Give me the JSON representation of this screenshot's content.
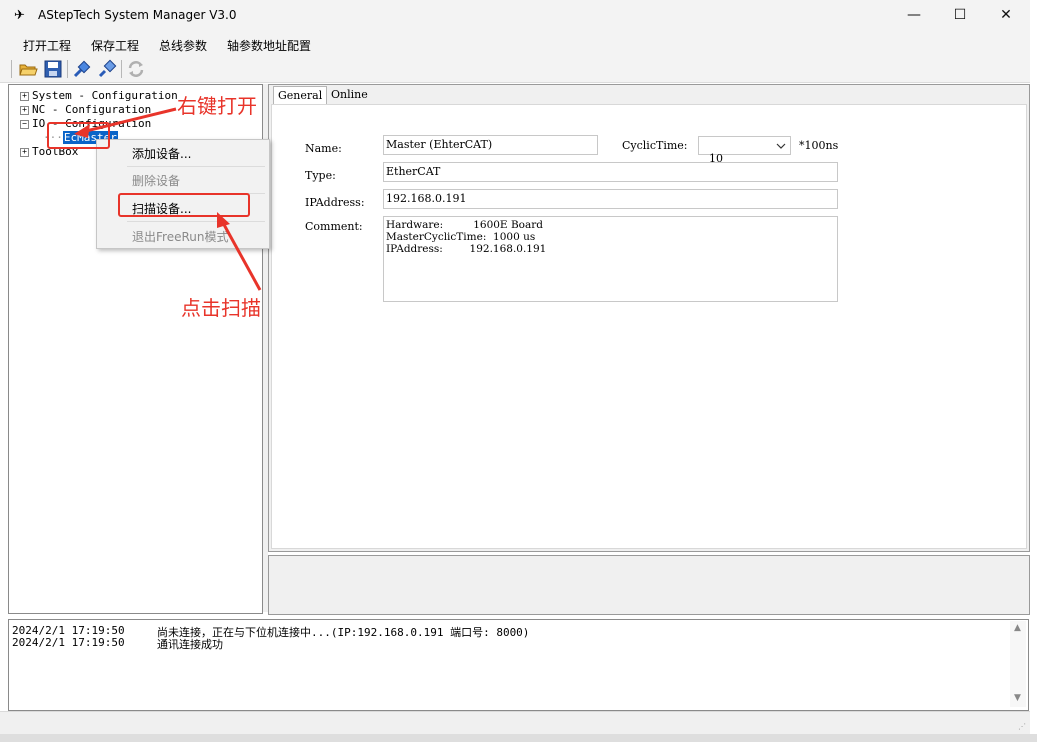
{
  "window": {
    "title": "AStepTech System Manager V3.0",
    "controls": {
      "minimize": "—",
      "maximize": "☐",
      "close": "✕"
    }
  },
  "menu": {
    "items": [
      "打开工程",
      "保存工程",
      "总线参数",
      "轴参数地址配置"
    ]
  },
  "toolbar": {
    "buttons": [
      "open-folder-icon",
      "save-icon",
      "connect-icon",
      "disconnect-icon",
      "refresh-icon"
    ]
  },
  "tree": {
    "items": [
      {
        "label": "System - Configuration",
        "expander": "+"
      },
      {
        "label": "NC - Configuration",
        "expander": "+"
      },
      {
        "label": "IO - Configuration",
        "expander": "−"
      },
      {
        "label": "EcMaster",
        "selected": true
      },
      {
        "label": "ToolBox",
        "expander": "+"
      }
    ]
  },
  "context_menu": {
    "items": [
      {
        "label": "添加设备...",
        "enabled": true
      },
      {
        "label": "删除设备",
        "enabled": false
      },
      {
        "label": "扫描设备...",
        "enabled": true
      },
      {
        "label": "退出FreeRun模式",
        "enabled": false
      }
    ]
  },
  "tabs": [
    "General",
    "Online"
  ],
  "form": {
    "name_label": "Name:",
    "name_value": "Master (EhterCAT)",
    "cyclic_label": "CyclicTime:",
    "cyclic_value": "10",
    "cyclic_unit": "*100ns",
    "type_label": "Type:",
    "type_value": "EtherCAT",
    "ip_label": "IPAddress:",
    "ip_value": "192.168.0.191",
    "comment_label": "Comment:",
    "comment_value": "Hardware:         1600E Board\nMasterCyclicTime:  1000 us\nIPAddress:        192.168.0.191"
  },
  "log": {
    "rows": [
      {
        "time": "2024/2/1 17:19:50",
        "message": "尚未连接，正在与下位机连接中...(IP:192.168.0.191 端口号: 8000)"
      },
      {
        "time": "2024/2/1 17:19:50",
        "message": "通讯连接成功"
      }
    ]
  },
  "annotations": {
    "right_click_text": "右键打开",
    "click_scan_text": "点击扫描",
    "color": "#e8342a"
  }
}
